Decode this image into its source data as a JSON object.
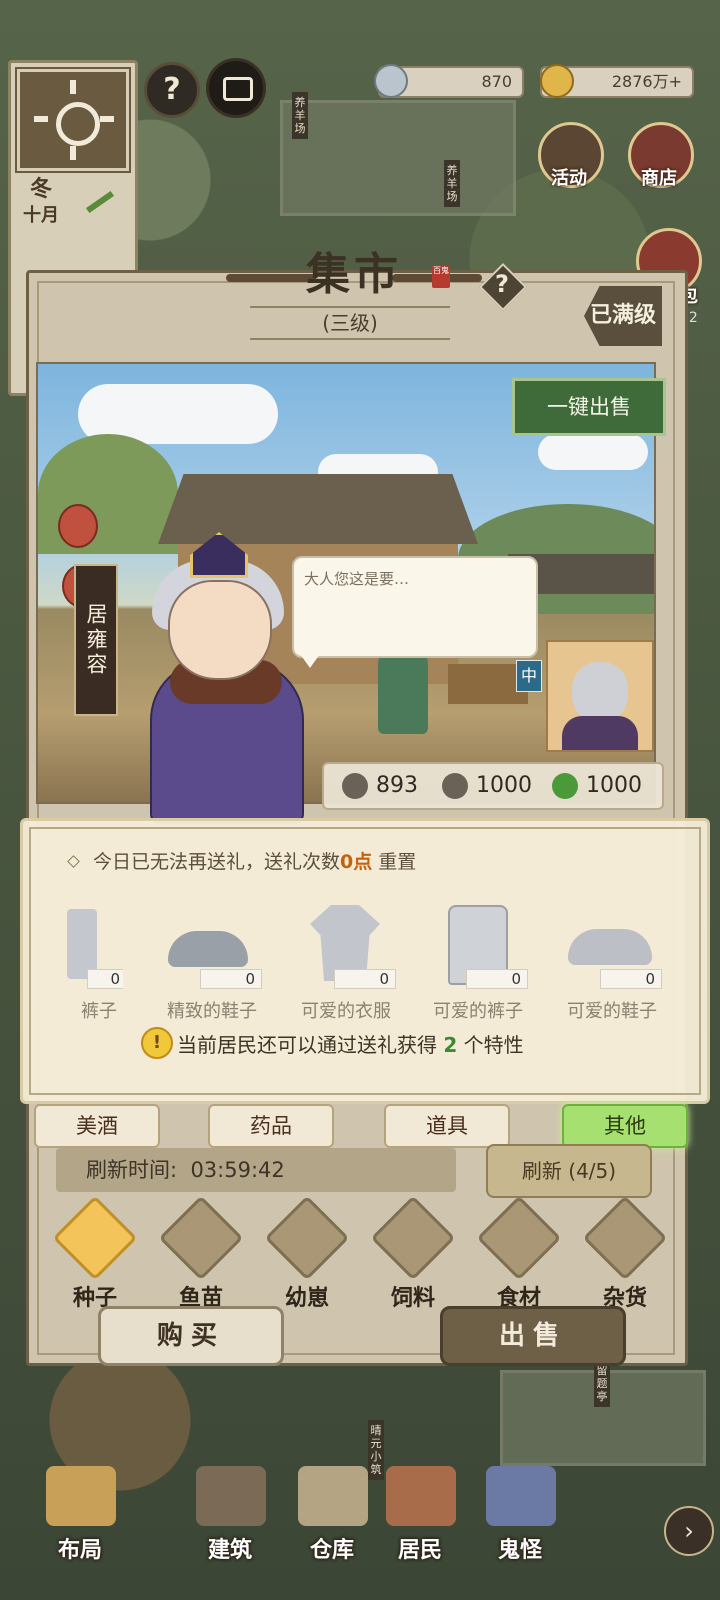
{
  "hud": {
    "season": "冬",
    "month": "十月",
    "silver": "870",
    "coins": "2876万+",
    "side_buttons": [
      {
        "label": "活动",
        "icon": "activity-scroll-icon"
      },
      {
        "label": "商店",
        "icon": "shop-gourd-icon"
      },
      {
        "label": "包",
        "icon": "backpack-icon"
      }
    ],
    "side_badge": "22",
    "map_signs": [
      "养羊场",
      "养羊场",
      "留题亭",
      "晴元小筑"
    ]
  },
  "market": {
    "title": "集市",
    "stamp": "百鬼",
    "level": "(三级)",
    "max_label": "已满级",
    "sell_all": "一键出售",
    "resident_name": "居雍容",
    "speech": "大人您这是要…",
    "mid_tag": "中",
    "stats": [
      {
        "icon": "muscle-icon",
        "value": "893"
      },
      {
        "icon": "heart-icon",
        "value": "1000"
      },
      {
        "icon": "leaf-icon",
        "value": "1000"
      }
    ]
  },
  "gift": {
    "notice_prefix": "今日已无法再送礼，送礼次数",
    "notice_count": "0点",
    "notice_suffix": " 重置",
    "items": [
      {
        "name": "裤子",
        "count": "0",
        "icon": "trousers-icon"
      },
      {
        "name": "精致的鞋子",
        "count": "0",
        "icon": "fine-shoes-icon"
      },
      {
        "name": "可爱的衣服",
        "count": "0",
        "icon": "cute-robe-icon"
      },
      {
        "name": "可爱的裤子",
        "count": "0",
        "icon": "cute-trousers-icon"
      },
      {
        "name": "可爱的鞋子",
        "count": "0",
        "icon": "cute-shoes-icon"
      }
    ],
    "tip_prefix": "当前居民还可以通过送礼获得",
    "tip_count": "2",
    "tip_suffix": "个特性"
  },
  "category_tabs": [
    "美酒",
    "药品",
    "道具",
    "其他"
  ],
  "active_category": "其他",
  "refresh": {
    "time_label": "刷新时间:",
    "time_value": "03:59:42",
    "button": "刷新 (4/5)"
  },
  "shop_tabs": [
    {
      "label": "种子",
      "icon": "seed-bag-icon"
    },
    {
      "label": "鱼苗",
      "icon": "fish-fry-icon"
    },
    {
      "label": "幼崽",
      "icon": "piglet-icon"
    },
    {
      "label": "饲料",
      "icon": "feed-sack-icon"
    },
    {
      "label": "食材",
      "icon": "teapot-icon"
    },
    {
      "label": "杂货",
      "icon": "hammer-icon"
    }
  ],
  "actions": {
    "buy": "购买",
    "sell": "出售"
  },
  "bottom_nav": [
    {
      "label": "布局",
      "icon": "layout-icon"
    },
    {
      "label": "建筑",
      "icon": "building-icon"
    },
    {
      "label": "仓库",
      "icon": "warehouse-icon"
    },
    {
      "label": "居民",
      "icon": "resident-icon"
    },
    {
      "label": "鬼怪",
      "icon": "ghost-icon"
    }
  ],
  "colors": {
    "panel": "#cfc5ae",
    "active_tab": "#a6e070",
    "sell_all_green": "#3f6b3a",
    "highlight_orange": "#c6620e",
    "tip_green": "#3a8a2e"
  }
}
